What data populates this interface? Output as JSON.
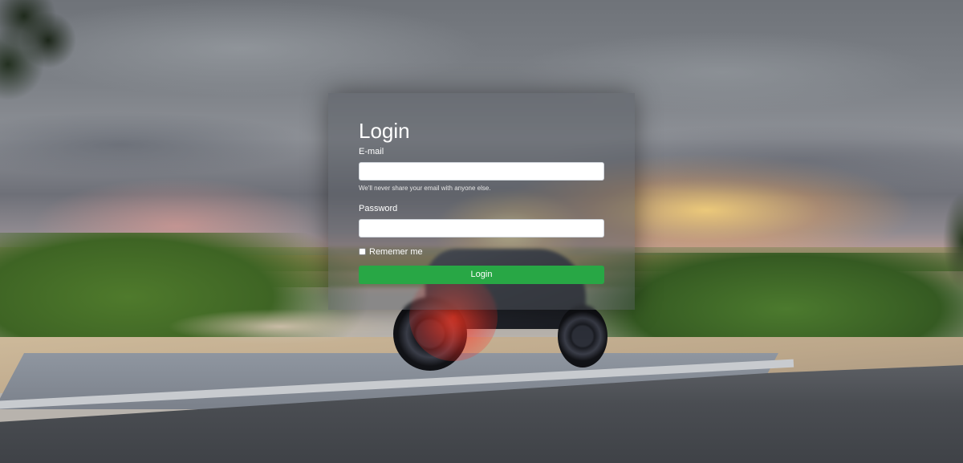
{
  "login": {
    "title": "Login",
    "email_label": "E-mail",
    "email_value": "",
    "email_help": "We'll never share your email with anyone else.",
    "password_label": "Password",
    "password_value": "",
    "remember_label": "Rememer me",
    "remember_checked": false,
    "button_label": "Login"
  },
  "colors": {
    "button": "#28a745",
    "panel": "rgba(80,84,92,0.45)",
    "text": "#ffffff"
  }
}
